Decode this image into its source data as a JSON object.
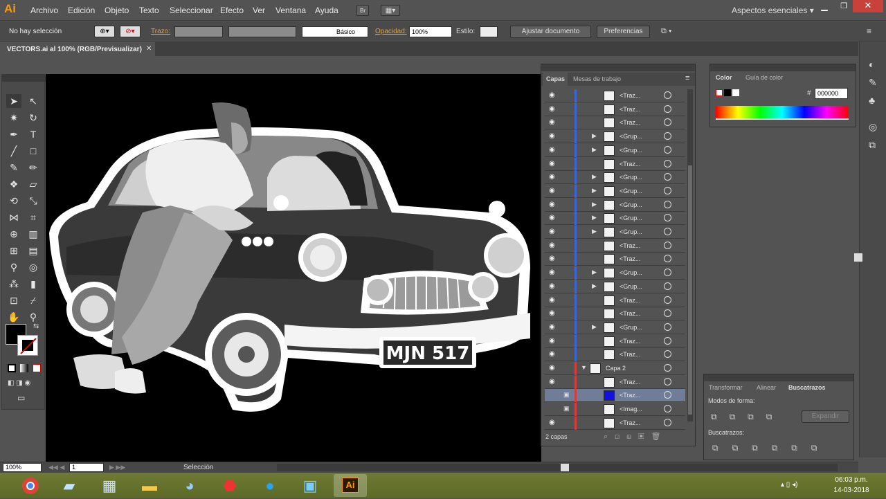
{
  "app": {
    "logo": "Ai",
    "workspace": "Aspectos esenciales"
  },
  "menu": [
    "Archivo",
    "Edición",
    "Objeto",
    "Texto",
    "Seleccionar",
    "Efecto",
    "Ver",
    "Ventana",
    "Ayuda"
  ],
  "control": {
    "selection_status": "No hay selección",
    "stroke_label": "Trazo:",
    "brush_label": "Básico",
    "opacity_label": "Opacidad:",
    "opacity_value": "100%",
    "style_label": "Estilo:",
    "doc_button": "Ajustar documento",
    "prefs_button": "Preferencias"
  },
  "document": {
    "tab_title": "VECTORS.ai al 100% (RGB/Previsualizar)",
    "plate": "MJN 517"
  },
  "layers_panel": {
    "tabs": [
      "Capas",
      "Mesas de trabajo"
    ],
    "rows": [
      {
        "name": "<Traz...",
        "group": false,
        "color": "#3b66d6"
      },
      {
        "name": "<Traz...",
        "group": false,
        "color": "#3b66d6"
      },
      {
        "name": "<Traz...",
        "group": false,
        "color": "#3b66d6"
      },
      {
        "name": "<Grup...",
        "group": true,
        "color": "#3b66d6"
      },
      {
        "name": "<Grup...",
        "group": true,
        "color": "#3b66d6"
      },
      {
        "name": "<Traz...",
        "group": false,
        "color": "#3b66d6"
      },
      {
        "name": "<Grup...",
        "group": true,
        "color": "#3b66d6"
      },
      {
        "name": "<Grup...",
        "group": true,
        "color": "#3b66d6"
      },
      {
        "name": "<Grup...",
        "group": true,
        "color": "#3b66d6"
      },
      {
        "name": "<Grup...",
        "group": true,
        "color": "#3b66d6"
      },
      {
        "name": "<Grup...",
        "group": true,
        "color": "#3b66d6"
      },
      {
        "name": "<Traz...",
        "group": false,
        "color": "#3b66d6"
      },
      {
        "name": "<Traz...",
        "group": false,
        "color": "#3b66d6"
      },
      {
        "name": "<Grup...",
        "group": true,
        "color": "#3b66d6"
      },
      {
        "name": "<Grup...",
        "group": true,
        "color": "#3b66d6"
      },
      {
        "name": "<Traz...",
        "group": false,
        "color": "#3b66d6"
      },
      {
        "name": "<Traz...",
        "group": false,
        "color": "#3b66d6"
      },
      {
        "name": "<Grup...",
        "group": true,
        "color": "#3b66d6"
      },
      {
        "name": "<Traz...",
        "group": false,
        "color": "#3b66d6"
      },
      {
        "name": "<Traz...",
        "group": false,
        "color": "#3b66d6"
      },
      {
        "name": "Capa 2",
        "layer": true,
        "color": "#d83b3b"
      },
      {
        "name": "<Traz...",
        "group": false,
        "color": "#d83b3b"
      },
      {
        "name": "<Traz...",
        "group": false,
        "color": "#d83b3b",
        "selected": true,
        "locked": true
      },
      {
        "name": "<Imag...",
        "group": false,
        "color": "#d83b3b",
        "locked": true
      },
      {
        "name": "<Traz...",
        "group": false,
        "color": "#d83b3b"
      }
    ],
    "footer": "2 capas"
  },
  "color_panel": {
    "tabs": [
      "Color",
      "Guía de color"
    ],
    "hex_label": "#",
    "hex_value": "000000"
  },
  "pathfinder": {
    "tabs": [
      "Transformar",
      "Alinear",
      "Buscatrazos"
    ],
    "shape_modes": "Modos de forma:",
    "expand": "Expandir",
    "pathfinders": "Buscatrazos:"
  },
  "status": {
    "zoom": "100%",
    "artboard": "1",
    "tool": "Selección"
  },
  "taskbar": {
    "time": "06:03 p.m.",
    "date": "14-03-2018",
    "ai_label": "Ai"
  }
}
